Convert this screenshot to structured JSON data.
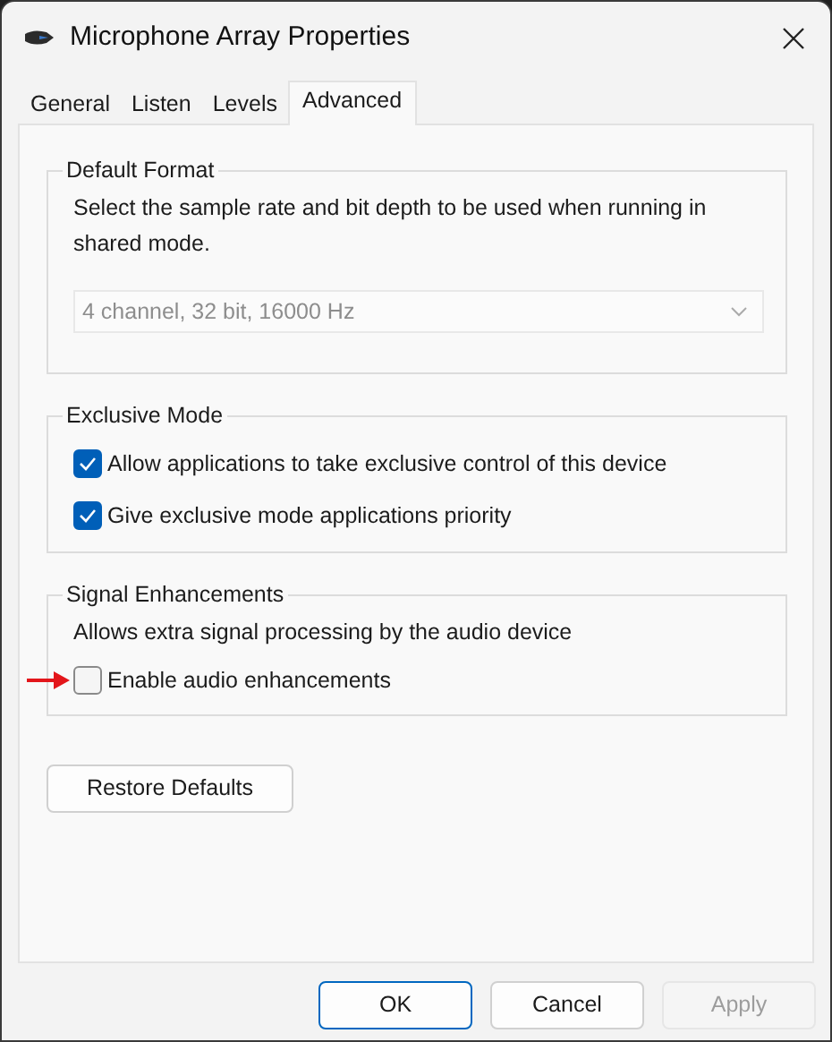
{
  "window": {
    "title": "Microphone Array Properties"
  },
  "tabs": [
    {
      "label": "General",
      "selected": false
    },
    {
      "label": "Listen",
      "selected": false
    },
    {
      "label": "Levels",
      "selected": false
    },
    {
      "label": "Advanced",
      "selected": true
    }
  ],
  "groups": [
    {
      "title": "Default Format",
      "items": [
        {
          "kind": "text",
          "text": "Select the sample rate and bit depth to be used when running in shared mode."
        },
        {
          "kind": "dropdown",
          "value": "4 channel, 32 bit, 16000 Hz",
          "disabled": true
        }
      ]
    },
    {
      "title": "Exclusive Mode",
      "items": [
        {
          "kind": "checkbox",
          "label": "Allow applications to take exclusive control of this device",
          "checked": true,
          "highlighted": false
        },
        {
          "kind": "checkbox",
          "label": "Give exclusive mode applications priority",
          "checked": true,
          "highlighted": false
        }
      ]
    },
    {
      "title": "Signal Enhancements",
      "items": [
        {
          "kind": "text",
          "text": "Allows extra signal processing by the audio device"
        },
        {
          "kind": "checkbox",
          "label": "Enable audio enhancements",
          "checked": false,
          "highlighted": true
        }
      ]
    }
  ],
  "restore_button": "Restore Defaults",
  "buttons": [
    {
      "label": "OK",
      "default": true,
      "disabled": false
    },
    {
      "label": "Cancel",
      "default": false,
      "disabled": false
    },
    {
      "label": "Apply",
      "default": false,
      "disabled": true
    }
  ]
}
